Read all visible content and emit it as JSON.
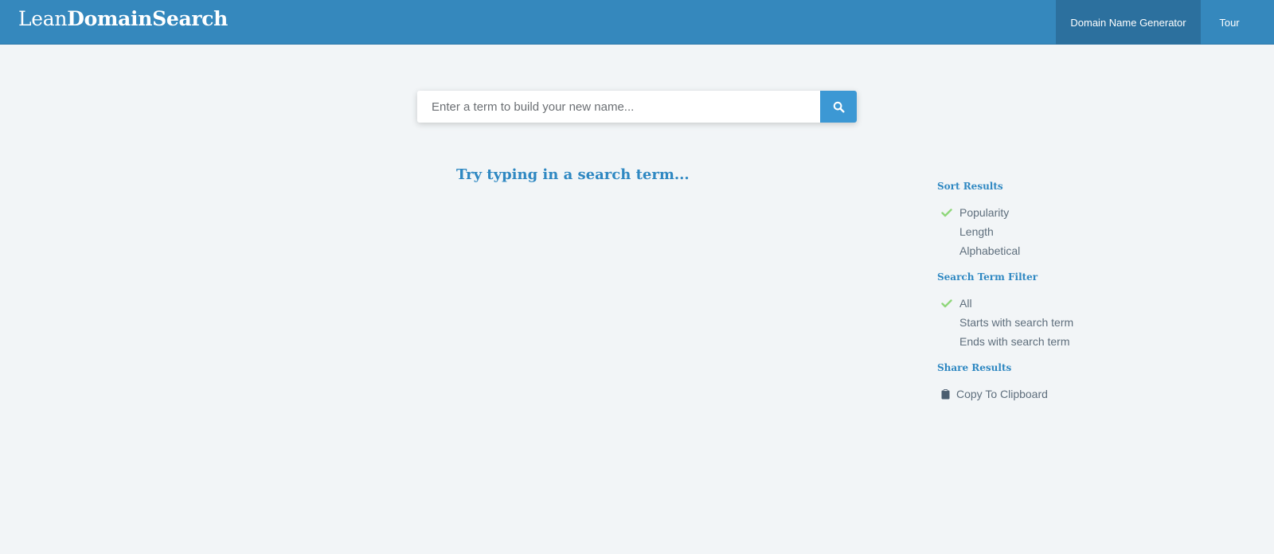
{
  "header": {
    "logo_light": "Lean",
    "logo_bold": "DomainSearch",
    "nav": [
      {
        "label": "Domain Name Generator",
        "active": true
      },
      {
        "label": "Tour",
        "active": false
      }
    ]
  },
  "search": {
    "placeholder": "Enter a term to build your new name...",
    "value": "",
    "button_icon": "search-icon"
  },
  "main": {
    "prompt": "Try typing in a search term..."
  },
  "sidebar": {
    "sort": {
      "title": "Sort Results",
      "options": [
        {
          "label": "Popularity",
          "selected": true
        },
        {
          "label": "Length",
          "selected": false
        },
        {
          "label": "Alphabetical",
          "selected": false
        }
      ]
    },
    "filter": {
      "title": "Search Term Filter",
      "options": [
        {
          "label": "All",
          "selected": true
        },
        {
          "label": "Starts with search term",
          "selected": false
        },
        {
          "label": "Ends with search term",
          "selected": false
        }
      ]
    },
    "share": {
      "title": "Share Results",
      "copy_label": "Copy To Clipboard",
      "copy_icon": "clipboard-icon"
    }
  },
  "colors": {
    "header_bg": "#3588bd",
    "nav_active_bg": "#2c709e",
    "accent": "#2f88c2",
    "search_button": "#3c98d4",
    "check": "#8fd77a",
    "page_bg": "#f2f5f7"
  }
}
